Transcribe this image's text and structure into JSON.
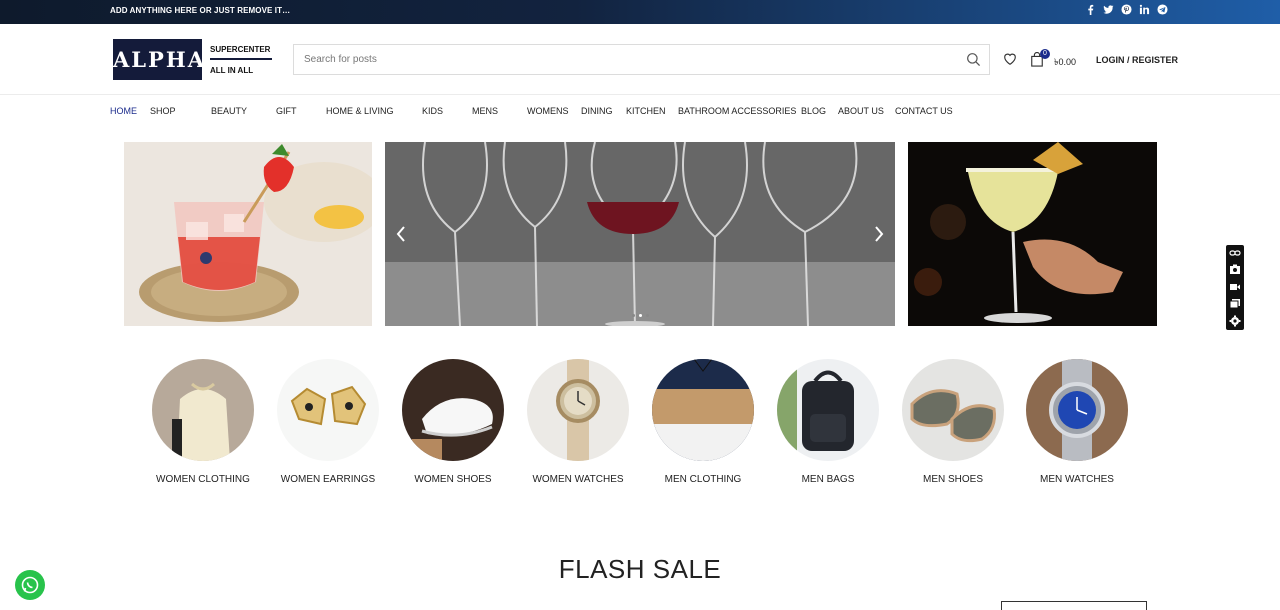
{
  "topbar": {
    "promo_text": "ADD ANYTHING HERE OR JUST REMOVE IT…",
    "social_icons": [
      "facebook-icon",
      "twitter-icon",
      "pinterest-icon",
      "linkedin-icon",
      "telegram-icon"
    ]
  },
  "header": {
    "logo": {
      "main": "ALPHA",
      "top": "SUPERCENTER",
      "bottom": "ALL IN ALL"
    },
    "search": {
      "placeholder": "Search for posts",
      "value": ""
    },
    "cart": {
      "count": "0",
      "total": "৳0.00"
    },
    "login_label": "LOGIN / REGISTER"
  },
  "nav": {
    "items": [
      {
        "label": "HOME",
        "active": true
      },
      {
        "label": "SHOP"
      },
      {
        "label": "BEAUTY"
      },
      {
        "label": "GIFT"
      },
      {
        "label": "HOME & LIVING"
      },
      {
        "label": "KIDS"
      },
      {
        "label": "MENS"
      },
      {
        "label": "WOMENS"
      },
      {
        "label": "DINING"
      },
      {
        "label": "KITCHEN"
      },
      {
        "label": "BATHROOM ACCESSORIES"
      },
      {
        "label": "BLOG"
      },
      {
        "label": "ABOUT US"
      },
      {
        "label": "CONTACT US"
      }
    ]
  },
  "slider": {
    "slides": 3,
    "active_slide": 1
  },
  "categories": [
    {
      "label": "WOMEN CLOTHING"
    },
    {
      "label": "WOMEN EARRINGS"
    },
    {
      "label": "WOMEN SHOES"
    },
    {
      "label": "WOMEN WATCHES"
    },
    {
      "label": "MEN CLOTHING"
    },
    {
      "label": "MEN BAGS"
    },
    {
      "label": "MEN SHOES"
    },
    {
      "label": "MEN WATCHES"
    }
  ],
  "flash_sale": {
    "title": "FLASH SALE"
  },
  "colors": {
    "brand_navy": "#141b3a",
    "accent_blue": "#1b2b8c",
    "whatsapp_green": "#28c34b"
  }
}
